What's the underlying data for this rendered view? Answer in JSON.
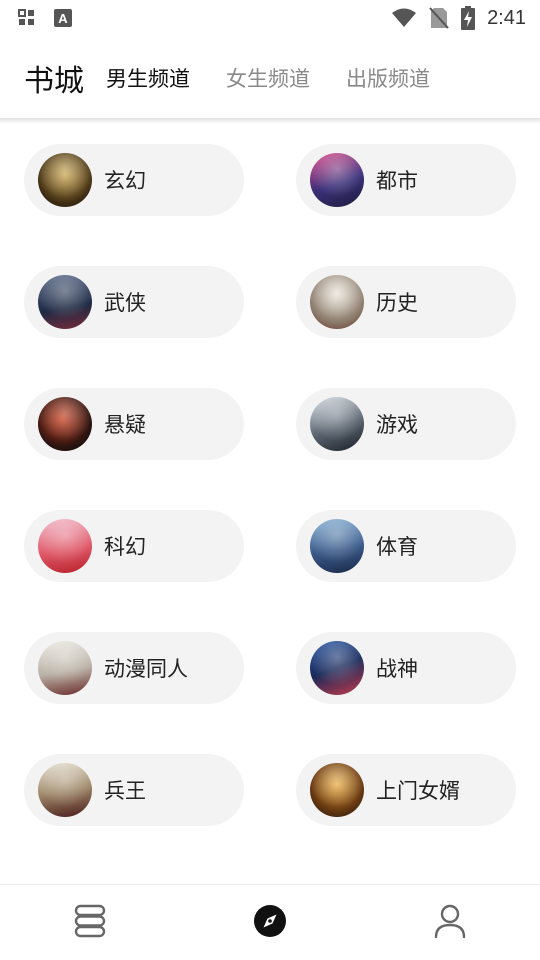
{
  "status_bar": {
    "time": "2:41",
    "icons": [
      "grid-apps-icon",
      "font-a-icon",
      "wifi-icon",
      "no-sim-icon",
      "battery-charging-icon"
    ]
  },
  "header": {
    "brand": "书城",
    "tabs": [
      {
        "label": "男生频道",
        "active": true
      },
      {
        "label": "女生频道",
        "active": false
      },
      {
        "label": "出版频道",
        "active": false
      }
    ]
  },
  "categories": [
    {
      "label": "玄幻"
    },
    {
      "label": "都市"
    },
    {
      "label": "武侠"
    },
    {
      "label": "历史"
    },
    {
      "label": "悬疑"
    },
    {
      "label": "游戏"
    },
    {
      "label": "科幻"
    },
    {
      "label": "体育"
    },
    {
      "label": "动漫同人"
    },
    {
      "label": "战神"
    },
    {
      "label": "兵王"
    },
    {
      "label": "上门女婿"
    }
  ],
  "bottom_nav": {
    "items": [
      "bookshelf-icon",
      "discover-compass-icon",
      "profile-icon"
    ],
    "active": "discover-compass-icon"
  },
  "colors": {
    "pill_bg": "#f3f3f3",
    "active_tab": "#111111",
    "inactive_tab": "#8a8a8a"
  }
}
